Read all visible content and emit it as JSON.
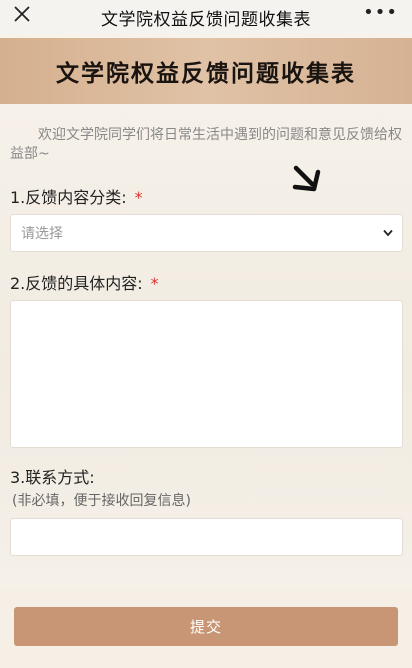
{
  "topbar": {
    "title": "文学院权益反馈问题收集表",
    "more": "•••"
  },
  "form": {
    "heading": "文学院权益反馈问题收集表",
    "intro": "欢迎文学院同学们将日常生活中遇到的问题和意见反馈给权益部~",
    "q1": {
      "label": "1.反馈内容分类:",
      "required": "*",
      "placeholder": "请选择"
    },
    "q2": {
      "label": "2.反馈的具体内容:",
      "required": "*"
    },
    "q3": {
      "label": "3.联系方式:",
      "hint": "(非必填，便于接收回复信息)"
    }
  },
  "footer": {
    "submit_label": "提交"
  },
  "colors": {
    "accent": "#c89674",
    "banner": "#dcbb9c",
    "required": "#dd3333"
  }
}
